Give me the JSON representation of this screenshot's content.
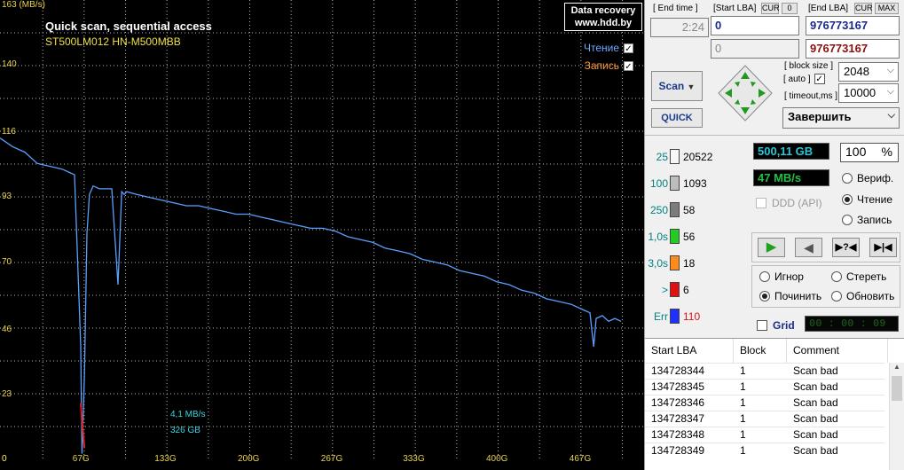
{
  "graph": {
    "unit_label": "163 (MB/s)",
    "title": "Quick scan, sequential access",
    "model": "ST500LM012 HN-M500MBB",
    "logo_line1": "Data recovery",
    "logo_line2": "www.hdd.by",
    "read_label": "Чтение",
    "write_label": "Запись",
    "speed_readout": "4,1 MB/s",
    "position_readout": "326 GB"
  },
  "chart_data": {
    "type": "line",
    "xlabel": "",
    "ylabel": "(MB/s)",
    "y_ticks": [
      "140",
      "116",
      "93",
      "70",
      "46",
      "23",
      "0"
    ],
    "x_ticks": [
      "67G",
      "133G",
      "200G",
      "267G",
      "333G",
      "400G",
      "467G"
    ],
    "ylim": [
      0,
      163
    ],
    "xlim": [
      0,
      500
    ],
    "grid": true,
    "series": [
      {
        "name": "Чтение",
        "color": "#5aa0ff",
        "x": [
          0,
          10,
          20,
          30,
          40,
          50,
          55,
          60,
          65,
          66,
          68,
          70,
          72,
          75,
          80,
          90,
          95,
          98,
          100,
          102,
          110,
          120,
          130,
          140,
          150,
          160,
          170,
          180,
          190,
          200,
          210,
          220,
          230,
          240,
          250,
          260,
          270,
          280,
          290,
          300,
          310,
          320,
          330,
          340,
          350,
          360,
          370,
          380,
          390,
          400,
          410,
          420,
          430,
          440,
          450,
          460,
          470,
          475,
          478,
          480,
          485,
          490,
          495,
          500
        ],
        "y": [
          114,
          111,
          109,
          105,
          104,
          103,
          102,
          101,
          40,
          2,
          30,
          80,
          94,
          97,
          96,
          96,
          62,
          95,
          94,
          95,
          94,
          93,
          92,
          91,
          90,
          90,
          89,
          88,
          87,
          87,
          86,
          85,
          84,
          83,
          82,
          82,
          81,
          79,
          78,
          77,
          75,
          74,
          73,
          71,
          70,
          69,
          67,
          66,
          65,
          63,
          62,
          60,
          59,
          57,
          56,
          55,
          53,
          52,
          40,
          50,
          51,
          49,
          50,
          49
        ]
      },
      {
        "name": "Запись",
        "color": "#e02020",
        "x": [
          65,
          66,
          67,
          68
        ],
        "y": [
          20,
          14,
          9,
          4
        ]
      }
    ]
  },
  "lba": {
    "end_time_label": "[ End time ]",
    "end_time_value": "2:24",
    "start_lba_label": "[Start LBA]",
    "cur_label": "CUR",
    "zero_label": "0",
    "start_lba_value": "0",
    "start_lba_value2": "0",
    "end_lba_label": "[End LBA]",
    "end_cur_label": "CUR",
    "max_label": "MAX",
    "end_lba_value": "976773167",
    "end_lba_value2": "976773167"
  },
  "controls": {
    "scan_label": "Scan",
    "quick_label": "QUICK",
    "block_size_label": "[ block size ]",
    "auto_label": "[ auto ]",
    "block_size_value": "2048",
    "timeout_label": "[ timeout,ms ]",
    "timeout_value": "10000",
    "finish_label": "Завершить"
  },
  "stats": {
    "rows": [
      {
        "label": "25",
        "value": "20522",
        "color": "#f7f7f7",
        "label_color": "#008080"
      },
      {
        "label": "100",
        "value": "1093",
        "color": "#bdbdbd",
        "label_color": "#008080"
      },
      {
        "label": "250",
        "value": "58",
        "color": "#7c7c7c",
        "label_color": "#008080"
      },
      {
        "label": "1,0s",
        "value": "56",
        "color": "#22cc22",
        "label_color": "#008080"
      },
      {
        "label": "3,0s",
        "value": "18",
        "color": "#ff8c1a",
        "label_color": "#008080"
      },
      {
        "label": ">",
        "value": "6",
        "color": "#e01010",
        "label_color": "#008080"
      },
      {
        "label": "Err",
        "value": "110",
        "color": "#2030ff",
        "label_color": "#008080",
        "value_color": "#e01010"
      }
    ],
    "size_display": "500,11 GB",
    "percent_display": "100",
    "percent_sign": "%",
    "speed_display": "47 MB/s",
    "ddd_label": "DDD (API)",
    "verify_label": "Вериф.",
    "read_label": "Чтение",
    "write_label": "Запись",
    "ignore_label": "Игнор",
    "erase_label": "Стереть",
    "repair_label": "Починить",
    "refresh_label": "Обновить",
    "grid_label": "Grid",
    "timer_display": "00 : 00 : 09"
  },
  "table": {
    "headers": [
      "Start LBA",
      "Block",
      "Comment"
    ],
    "rows": [
      [
        "134728344",
        "1",
        "Scan bad"
      ],
      [
        "134728345",
        "1",
        "Scan bad"
      ],
      [
        "134728346",
        "1",
        "Scan bad"
      ],
      [
        "134728347",
        "1",
        "Scan bad"
      ],
      [
        "134728348",
        "1",
        "Scan bad"
      ],
      [
        "134728349",
        "1",
        "Scan bad"
      ]
    ]
  }
}
